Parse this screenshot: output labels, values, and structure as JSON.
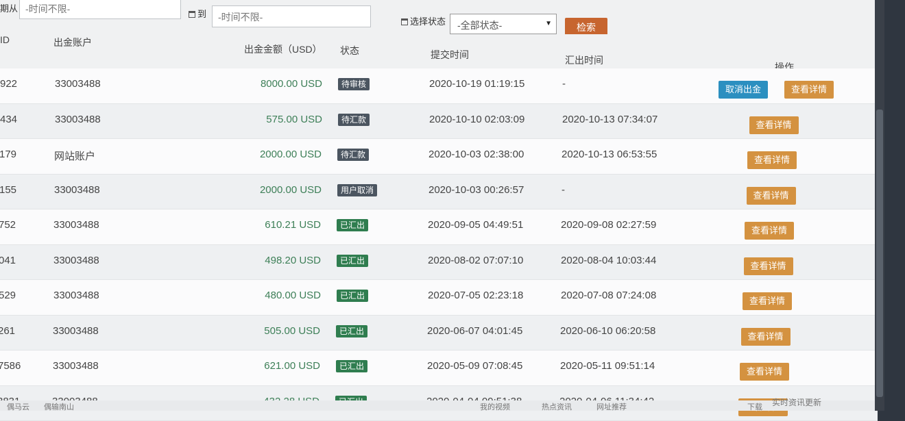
{
  "filters": {
    "from_label": "期从",
    "from_value": "-时间不限-",
    "to_label": "到",
    "to_value": "-时间不限-",
    "status_label": "选择状态",
    "status_value": "-全部状态-",
    "search_label": "检索"
  },
  "table": {
    "columns": {
      "id": "ID",
      "account": "出金账户",
      "amount": "出金金额（USD）",
      "status": "状态",
      "submit_time": "提交时间",
      "remit_time": "汇出时间",
      "actions": "操作"
    },
    "rows": [
      {
        "id": "922",
        "account": "33003488",
        "amount": "8000.00 USD",
        "status": "待审核",
        "status_kind": "dark",
        "submit": "2020-10-19 01:19:15",
        "remit": "-",
        "actions": [
          "取消出金",
          "查看详情"
        ]
      },
      {
        "id": "434",
        "account": "33003488",
        "amount": "575.00 USD",
        "status": "待汇款",
        "status_kind": "dark",
        "submit": "2020-10-10 02:03:09",
        "remit": "2020-10-13 07:34:07",
        "actions": [
          "查看详情"
        ]
      },
      {
        "id": "179",
        "account": "网站账户",
        "amount": "2000.00 USD",
        "status": "待汇款",
        "status_kind": "dark",
        "submit": "2020-10-03 02:38:00",
        "remit": "2020-10-13 06:53:55",
        "actions": [
          "查看详情"
        ]
      },
      {
        "id": "155",
        "account": "33003488",
        "amount": "2000.00 USD",
        "status": "用户取消",
        "status_kind": "dark",
        "submit": "2020-10-03 00:26:57",
        "remit": "-",
        "actions": [
          "查看详情"
        ]
      },
      {
        "id": "752",
        "account": "33003488",
        "amount": "610.21 USD",
        "status": "已汇出",
        "status_kind": "green",
        "submit": "2020-09-05 04:49:51",
        "remit": "2020-09-08 02:27:59",
        "actions": [
          "查看详情"
        ]
      },
      {
        "id": "041",
        "account": "33003488",
        "amount": "498.20 USD",
        "status": "已汇出",
        "status_kind": "green",
        "submit": "2020-08-02 07:07:10",
        "remit": "2020-08-04 10:03:44",
        "actions": [
          "查看详情"
        ]
      },
      {
        "id": "529",
        "account": "33003488",
        "amount": "480.00 USD",
        "status": "已汇出",
        "status_kind": "green",
        "submit": "2020-07-05 02:23:18",
        "remit": "2020-07-08 07:24:08",
        "actions": [
          "查看详情"
        ]
      },
      {
        "id": "261",
        "account": "33003488",
        "amount": "505.00 USD",
        "status": "已汇出",
        "status_kind": "green",
        "submit": "2020-06-07 04:01:45",
        "remit": "2020-06-10 06:20:58",
        "actions": [
          "查看详情"
        ]
      },
      {
        "id": "7586",
        "account": "33003488",
        "amount": "621.00 USD",
        "status": "已汇出",
        "status_kind": "green",
        "submit": "2020-05-09 07:08:45",
        "remit": "2020-05-11 09:51:14",
        "actions": [
          "查看详情"
        ]
      },
      {
        "id": "3831",
        "account": "33003488",
        "amount": "432.28 USD",
        "status": "已汇出",
        "status_kind": "green",
        "submit": "2020-04-04 09:51:38",
        "remit": "2020-04-06 11:34:42",
        "actions": [
          "查看详情"
        ]
      }
    ]
  },
  "footer": {
    "left1": "偶马云",
    "left2": "偶输南山",
    "right1": "我的视频",
    "right2": "热点资讯",
    "right3": "网址推荐",
    "right4": "下载",
    "news": "实时资讯更新"
  },
  "colors": {
    "search": "#c7652f",
    "detail": "#d49240",
    "cancel": "#2b8fc0",
    "badge_dark": "#4b5560",
    "badge_green": "#2f7d4f",
    "amount": "#3d7f57"
  }
}
